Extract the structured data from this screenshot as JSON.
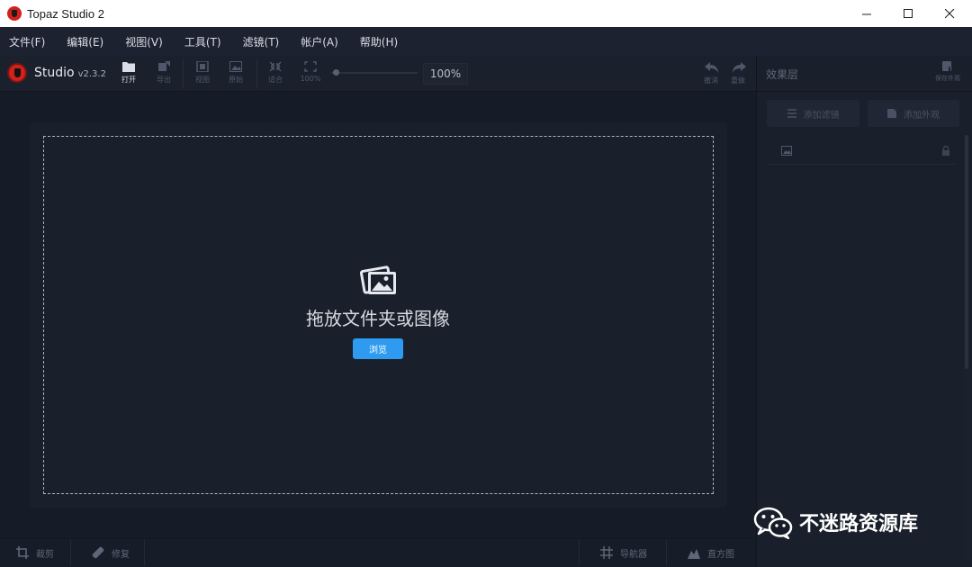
{
  "window": {
    "title": "Topaz Studio 2",
    "controls": [
      "minimize",
      "maximize",
      "close"
    ]
  },
  "menu": {
    "items": [
      "文件(F)",
      "编辑(E)",
      "视图(V)",
      "工具(T)",
      "滤镜(T)",
      "帐户(A)",
      "帮助(H)"
    ]
  },
  "toolbar": {
    "brand_name": "Studio",
    "version": "v2.3.2",
    "buttons": [
      {
        "label": "打开",
        "icon": "folder-icon",
        "enabled": true
      },
      {
        "label": "导出",
        "icon": "export-icon",
        "enabled": false
      },
      {
        "label": "视图",
        "icon": "view-icon",
        "enabled": false
      },
      {
        "label": "原始",
        "icon": "original-image-icon",
        "enabled": false
      },
      {
        "label": "适合",
        "icon": "fit-icon",
        "enabled": false
      },
      {
        "label": "100%",
        "icon": "actual-size-icon",
        "enabled": false
      }
    ],
    "zoom": "100%",
    "undo_label": "撤消",
    "redo_label": "重做"
  },
  "canvas": {
    "drop_text": "拖放文件夹或图像",
    "browse_label": "浏览"
  },
  "bottom_bar": {
    "crop_label": "裁剪",
    "repair_label": "修复",
    "navigator_label": "导航器",
    "histogram_label": "直方图"
  },
  "right_panel": {
    "title": "效果层",
    "save_look_label": "保存外观",
    "add_filter_label": "添加滤镜",
    "add_look_label": "添加外观"
  },
  "watermark": {
    "text": "不迷路资源库"
  },
  "colors": {
    "accent": "#2e9bf0",
    "background": "#161c27",
    "logo_red": "#d2211b"
  }
}
